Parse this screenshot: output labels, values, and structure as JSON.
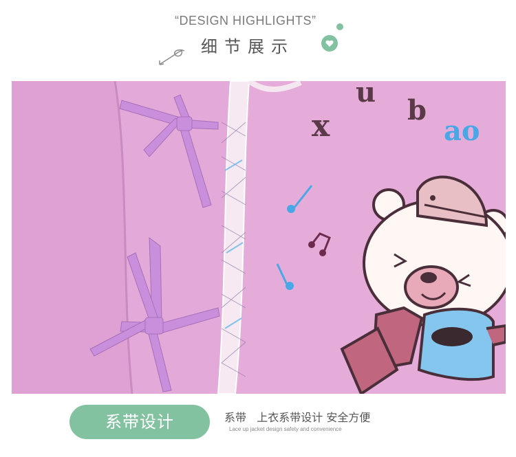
{
  "header": {
    "title_en": "“DESIGN HIGHLIGHTS”",
    "title_zh": "细节展示"
  },
  "photo": {
    "print_letters": [
      "x",
      "u",
      "b",
      "ao"
    ],
    "colors": {
      "fabric": "#e2a6d6",
      "ties": "#c98fdc",
      "letters": "#5a3a48",
      "accent_blue": "#4aa7e6"
    }
  },
  "feature": {
    "badge": "系带设计",
    "description_zh": "系带   上衣系带设计 安全方便",
    "description_en": "Lace up jacket design safety and convenience"
  },
  "icons": [
    "swirl-arrow-icon",
    "dot-icon",
    "heart-bubble-icon"
  ]
}
